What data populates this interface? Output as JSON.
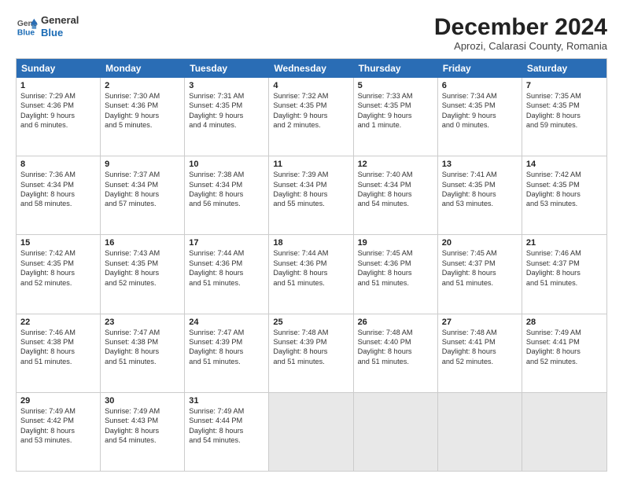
{
  "logo": {
    "line1": "General",
    "line2": "Blue"
  },
  "title": "December 2024",
  "location": "Aprozi, Calarasi County, Romania",
  "weekdays": [
    "Sunday",
    "Monday",
    "Tuesday",
    "Wednesday",
    "Thursday",
    "Friday",
    "Saturday"
  ],
  "weeks": [
    [
      {
        "day": "1",
        "sunrise": "Sunrise: 7:29 AM",
        "sunset": "Sunset: 4:36 PM",
        "daylight": "Daylight: 9 hours and 6 minutes."
      },
      {
        "day": "2",
        "sunrise": "Sunrise: 7:30 AM",
        "sunset": "Sunset: 4:36 PM",
        "daylight": "Daylight: 9 hours and 5 minutes."
      },
      {
        "day": "3",
        "sunrise": "Sunrise: 7:31 AM",
        "sunset": "Sunset: 4:35 PM",
        "daylight": "Daylight: 9 hours and 4 minutes."
      },
      {
        "day": "4",
        "sunrise": "Sunrise: 7:32 AM",
        "sunset": "Sunset: 4:35 PM",
        "daylight": "Daylight: 9 hours and 2 minutes."
      },
      {
        "day": "5",
        "sunrise": "Sunrise: 7:33 AM",
        "sunset": "Sunset: 4:35 PM",
        "daylight": "Daylight: 9 hours and 1 minute."
      },
      {
        "day": "6",
        "sunrise": "Sunrise: 7:34 AM",
        "sunset": "Sunset: 4:35 PM",
        "daylight": "Daylight: 9 hours and 0 minutes."
      },
      {
        "day": "7",
        "sunrise": "Sunrise: 7:35 AM",
        "sunset": "Sunset: 4:35 PM",
        "daylight": "Daylight: 8 hours and 59 minutes."
      }
    ],
    [
      {
        "day": "8",
        "sunrise": "Sunrise: 7:36 AM",
        "sunset": "Sunset: 4:34 PM",
        "daylight": "Daylight: 8 hours and 58 minutes."
      },
      {
        "day": "9",
        "sunrise": "Sunrise: 7:37 AM",
        "sunset": "Sunset: 4:34 PM",
        "daylight": "Daylight: 8 hours and 57 minutes."
      },
      {
        "day": "10",
        "sunrise": "Sunrise: 7:38 AM",
        "sunset": "Sunset: 4:34 PM",
        "daylight": "Daylight: 8 hours and 56 minutes."
      },
      {
        "day": "11",
        "sunrise": "Sunrise: 7:39 AM",
        "sunset": "Sunset: 4:34 PM",
        "daylight": "Daylight: 8 hours and 55 minutes."
      },
      {
        "day": "12",
        "sunrise": "Sunrise: 7:40 AM",
        "sunset": "Sunset: 4:34 PM",
        "daylight": "Daylight: 8 hours and 54 minutes."
      },
      {
        "day": "13",
        "sunrise": "Sunrise: 7:41 AM",
        "sunset": "Sunset: 4:35 PM",
        "daylight": "Daylight: 8 hours and 53 minutes."
      },
      {
        "day": "14",
        "sunrise": "Sunrise: 7:42 AM",
        "sunset": "Sunset: 4:35 PM",
        "daylight": "Daylight: 8 hours and 53 minutes."
      }
    ],
    [
      {
        "day": "15",
        "sunrise": "Sunrise: 7:42 AM",
        "sunset": "Sunset: 4:35 PM",
        "daylight": "Daylight: 8 hours and 52 minutes."
      },
      {
        "day": "16",
        "sunrise": "Sunrise: 7:43 AM",
        "sunset": "Sunset: 4:35 PM",
        "daylight": "Daylight: 8 hours and 52 minutes."
      },
      {
        "day": "17",
        "sunrise": "Sunrise: 7:44 AM",
        "sunset": "Sunset: 4:36 PM",
        "daylight": "Daylight: 8 hours and 51 minutes."
      },
      {
        "day": "18",
        "sunrise": "Sunrise: 7:44 AM",
        "sunset": "Sunset: 4:36 PM",
        "daylight": "Daylight: 8 hours and 51 minutes."
      },
      {
        "day": "19",
        "sunrise": "Sunrise: 7:45 AM",
        "sunset": "Sunset: 4:36 PM",
        "daylight": "Daylight: 8 hours and 51 minutes."
      },
      {
        "day": "20",
        "sunrise": "Sunrise: 7:45 AM",
        "sunset": "Sunset: 4:37 PM",
        "daylight": "Daylight: 8 hours and 51 minutes."
      },
      {
        "day": "21",
        "sunrise": "Sunrise: 7:46 AM",
        "sunset": "Sunset: 4:37 PM",
        "daylight": "Daylight: 8 hours and 51 minutes."
      }
    ],
    [
      {
        "day": "22",
        "sunrise": "Sunrise: 7:46 AM",
        "sunset": "Sunset: 4:38 PM",
        "daylight": "Daylight: 8 hours and 51 minutes."
      },
      {
        "day": "23",
        "sunrise": "Sunrise: 7:47 AM",
        "sunset": "Sunset: 4:38 PM",
        "daylight": "Daylight: 8 hours and 51 minutes."
      },
      {
        "day": "24",
        "sunrise": "Sunrise: 7:47 AM",
        "sunset": "Sunset: 4:39 PM",
        "daylight": "Daylight: 8 hours and 51 minutes."
      },
      {
        "day": "25",
        "sunrise": "Sunrise: 7:48 AM",
        "sunset": "Sunset: 4:39 PM",
        "daylight": "Daylight: 8 hours and 51 minutes."
      },
      {
        "day": "26",
        "sunrise": "Sunrise: 7:48 AM",
        "sunset": "Sunset: 4:40 PM",
        "daylight": "Daylight: 8 hours and 51 minutes."
      },
      {
        "day": "27",
        "sunrise": "Sunrise: 7:48 AM",
        "sunset": "Sunset: 4:41 PM",
        "daylight": "Daylight: 8 hours and 52 minutes."
      },
      {
        "day": "28",
        "sunrise": "Sunrise: 7:49 AM",
        "sunset": "Sunset: 4:41 PM",
        "daylight": "Daylight: 8 hours and 52 minutes."
      }
    ],
    [
      {
        "day": "29",
        "sunrise": "Sunrise: 7:49 AM",
        "sunset": "Sunset: 4:42 PM",
        "daylight": "Daylight: 8 hours and 53 minutes."
      },
      {
        "day": "30",
        "sunrise": "Sunrise: 7:49 AM",
        "sunset": "Sunset: 4:43 PM",
        "daylight": "Daylight: 8 hours and 54 minutes."
      },
      {
        "day": "31",
        "sunrise": "Sunrise: 7:49 AM",
        "sunset": "Sunset: 4:44 PM",
        "daylight": "Daylight: 8 hours and 54 minutes."
      },
      null,
      null,
      null,
      null
    ]
  ]
}
